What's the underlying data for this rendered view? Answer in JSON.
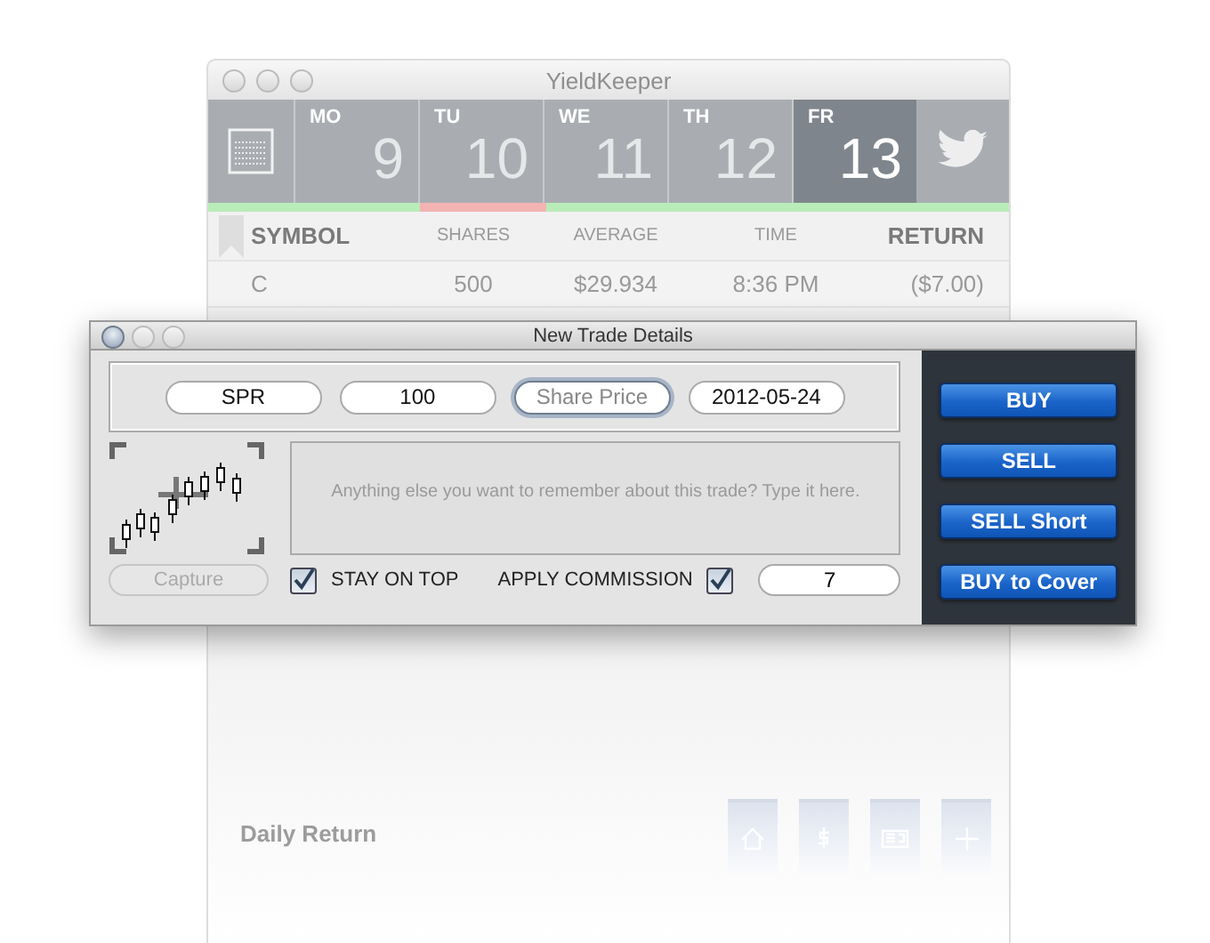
{
  "background_window": {
    "title": "YieldKeeper",
    "days": [
      {
        "weekday": "MO",
        "date": "9",
        "selected": false,
        "color": "#b9ecb9"
      },
      {
        "weekday": "TU",
        "date": "10",
        "selected": false,
        "color": "#f3b3b3"
      },
      {
        "weekday": "WE",
        "date": "11",
        "selected": false,
        "color": "#b9ecb9"
      },
      {
        "weekday": "TH",
        "date": "12",
        "selected": false,
        "color": "#b9ecb9"
      },
      {
        "weekday": "FR",
        "date": "13",
        "selected": true,
        "color": "#b9ecb9"
      }
    ],
    "table": {
      "columns": [
        {
          "label": "SYMBOL",
          "emphasized": true
        },
        {
          "label": "SHARES",
          "emphasized": false
        },
        {
          "label": "AVERAGE",
          "emphasized": false
        },
        {
          "label": "TIME",
          "emphasized": false
        },
        {
          "label": "RETURN",
          "emphasized": true
        }
      ],
      "rows": [
        [
          "C",
          "500",
          "$29.934",
          "8:36 PM",
          "($7.00)"
        ]
      ]
    },
    "daily_return": {
      "title": "Daily Return"
    },
    "bottom_tabs": [
      {
        "kind": "home"
      },
      {
        "kind": "dollar"
      },
      {
        "kind": "news"
      },
      {
        "kind": "add"
      }
    ]
  },
  "dialog": {
    "title": "New Trade Details",
    "fields": [
      {
        "value": "SPR",
        "focused": false
      },
      {
        "value": "100",
        "focused": false
      },
      {
        "placeholder": "Share Price",
        "focused": true
      },
      {
        "value": "2012-05-24",
        "focused": false
      }
    ],
    "notes": {
      "placeholder": "Anything else you want to remember about this trade? Type it here."
    },
    "capture_button": {
      "label": "Capture",
      "disabled": true
    },
    "stay_on_top": {
      "label": "STAY ON TOP",
      "checked": true
    },
    "commission": {
      "label": "APPLY COMMISSION",
      "checked": true,
      "value": "7"
    },
    "actions": [
      "BUY",
      "SELL",
      "SELL Short",
      "BUY to Cover"
    ]
  }
}
